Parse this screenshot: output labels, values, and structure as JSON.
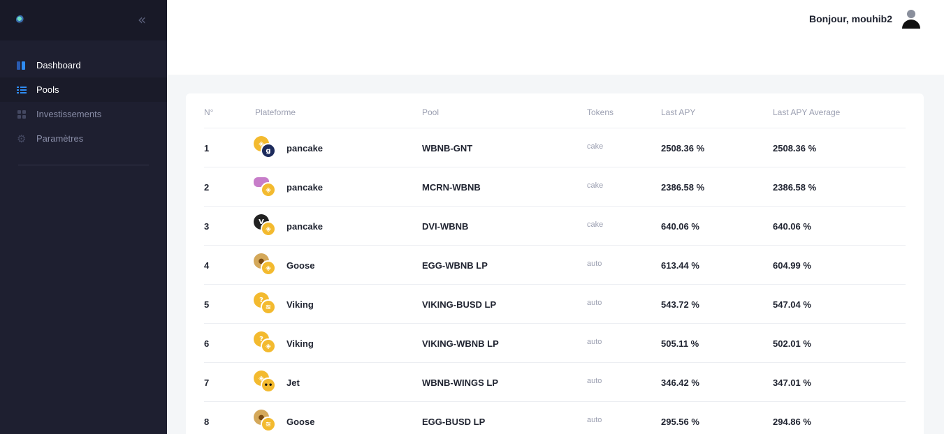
{
  "sidebar": {
    "collapse_icon": "double-chevron-left-icon",
    "items": [
      {
        "label": "Dashboard",
        "icon": "dashboard-icon"
      },
      {
        "label": "Pools",
        "icon": "list-icon"
      },
      {
        "label": "Investissements",
        "icon": "grid-icon"
      },
      {
        "label": "Paramètres",
        "icon": "gear-icon"
      }
    ]
  },
  "header": {
    "greeting": "Bonjour, mouhib2",
    "avatar_icon": "user-icon"
  },
  "table": {
    "columns": [
      "N°",
      "Plateforme",
      "Pool",
      "Tokens",
      "Last APY",
      "Last APY Average"
    ],
    "rows": [
      {
        "n": "1",
        "platform": "pancake",
        "pool": "WBNB-GNT",
        "tokens": "cake",
        "last_apy": "2508.36 %",
        "avg_apy": "2508.36 %"
      },
      {
        "n": "2",
        "platform": "pancake",
        "pool": "MCRN-WBNB",
        "tokens": "cake",
        "last_apy": "2386.58 %",
        "avg_apy": "2386.58 %"
      },
      {
        "n": "3",
        "platform": "pancake",
        "pool": "DVI-WBNB",
        "tokens": "cake",
        "last_apy": "640.06 %",
        "avg_apy": "640.06 %"
      },
      {
        "n": "4",
        "platform": "Goose",
        "pool": "EGG-WBNB LP",
        "tokens": "auto",
        "last_apy": "613.44 %",
        "avg_apy": "604.99 %"
      },
      {
        "n": "5",
        "platform": "Viking",
        "pool": "VIKING-BUSD LP",
        "tokens": "auto",
        "last_apy": "543.72 %",
        "avg_apy": "547.04 %"
      },
      {
        "n": "6",
        "platform": "Viking",
        "pool": "VIKING-WBNB LP",
        "tokens": "auto",
        "last_apy": "505.11 %",
        "avg_apy": "502.01 %"
      },
      {
        "n": "7",
        "platform": "Jet",
        "pool": "WBNB-WINGS LP",
        "tokens": "auto",
        "last_apy": "346.42 %",
        "avg_apy": "347.01 %"
      },
      {
        "n": "8",
        "platform": "Goose",
        "pool": "EGG-BUSD LP",
        "tokens": "auto",
        "last_apy": "295.56 %",
        "avg_apy": "294.86 %"
      }
    ]
  }
}
